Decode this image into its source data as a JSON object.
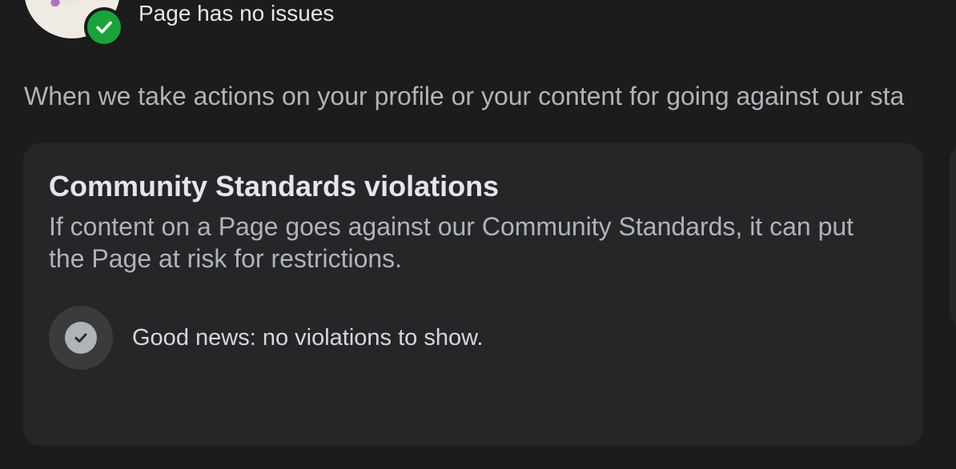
{
  "header": {
    "status_text": "Page has no issues"
  },
  "intro": {
    "text": "When we take actions on your profile or your content for going against our sta"
  },
  "card": {
    "title": "Community Standards violations",
    "description": "If content on a Page goes against our Community Standards, it can put the Page at risk for restrictions.",
    "result_text": "Good news: no violations to show."
  },
  "colors": {
    "background": "#1c1c1d",
    "card": "#252628",
    "success_green": "#1aa33b",
    "secondary_text": "#b0b3b8"
  },
  "icons": {
    "status_badge": "check-circle-icon",
    "result": "check-circle-icon"
  }
}
